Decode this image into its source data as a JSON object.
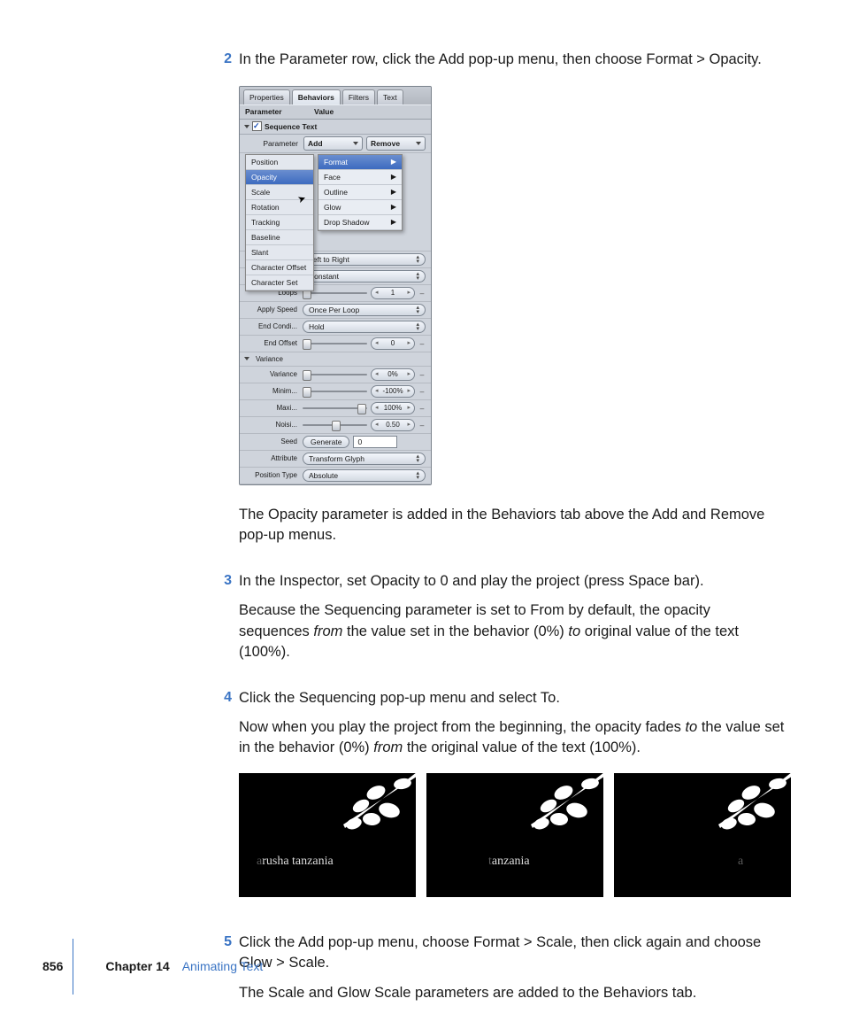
{
  "steps": {
    "s2": {
      "num": "2",
      "p1": "In the Parameter row, click the Add pop-up menu, then choose Format > Opacity.",
      "p2": "The Opacity parameter is added in the Behaviors tab above the Add and Remove pop-up menus."
    },
    "s3": {
      "num": "3",
      "p1": "In the Inspector, set Opacity to 0 and play the project (press Space bar).",
      "p2a": "Because the Sequencing parameter is set to From by default, the opacity sequences ",
      "p2i": "from",
      "p2b": " the value set in the behavior (0%) ",
      "p2i2": "to",
      "p2c": " original value of the text (100%)."
    },
    "s4": {
      "num": "4",
      "p1": "Click the Sequencing pop-up menu and select To.",
      "p2a": "Now when you play the project from the beginning, the opacity fades ",
      "p2i": "to",
      "p2b": " the value set in the behavior (0%) ",
      "p2i2": "from",
      "p2c": " the original value of the text (100%)."
    },
    "s5": {
      "num": "5",
      "p1": "Click the Add pop-up menu, choose Format > Scale, then click again and choose Glow > Scale.",
      "p2": "The Scale and Glow Scale parameters are added to the Behaviors tab."
    }
  },
  "panel": {
    "tabs": {
      "a": "Properties",
      "b": "Behaviors",
      "c": "Filters",
      "d": "Text"
    },
    "hdr": {
      "a": "Parameter",
      "b": "Value"
    },
    "seq": "Sequence Text",
    "paramLabel": "Parameter",
    "add": "Add",
    "remove": "Remove",
    "menu1": {
      "a": "Position",
      "b": "Opacity",
      "c": "Scale",
      "d": "Rotation",
      "e": "Tracking",
      "f": "Baseline",
      "g": "Slant",
      "h": "Character Offset",
      "i": "Character Set"
    },
    "menu2": {
      "a": "Format",
      "b": "Face",
      "c": "Outline",
      "d": "Glow",
      "e": "Drop Shadow"
    },
    "f1": {
      "l": "",
      "v": "Left to Right"
    },
    "f2": {
      "l": "",
      "v": "Constant"
    },
    "loops": {
      "l": "Loops",
      "v": "1"
    },
    "aspd": {
      "l": "Apply Speed",
      "v": "Once Per Loop"
    },
    "endc": {
      "l": "End Condi...",
      "v": "Hold"
    },
    "endo": {
      "l": "End Offset",
      "v": "0"
    },
    "var": {
      "l": "Variance"
    },
    "vr": {
      "l": "Variance",
      "v": "0%"
    },
    "mn": {
      "l": "Minim...",
      "v": "-100%"
    },
    "mx": {
      "l": "Maxi...",
      "v": "100%"
    },
    "ns": {
      "l": "Noisi...",
      "v": "0.50"
    },
    "seed": {
      "l": "Seed",
      "b": "Generate",
      "v": "0"
    },
    "attr": {
      "l": "Attribute",
      "v": "Transform Glyph"
    },
    "pt": {
      "l": "Position Type",
      "v": "Absolute"
    }
  },
  "thumbs": {
    "a": {
      "f": "a",
      "t": "rusha tanzania"
    },
    "b": {
      "f": "t",
      "t": "anzania"
    },
    "c": {
      "f": "a",
      "t": ""
    }
  },
  "footer": {
    "page": "856",
    "ch": "Chapter 14",
    "title": "Animating Text"
  }
}
